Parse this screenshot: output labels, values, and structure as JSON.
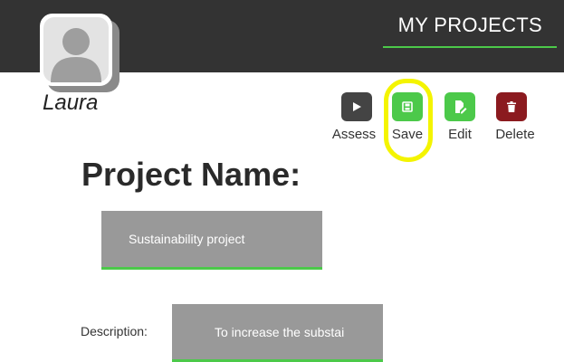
{
  "header": {
    "title": "MY PROJECTS"
  },
  "user": {
    "name": "Laura"
  },
  "actions": [
    {
      "label": "Assess",
      "icon": "play-icon"
    },
    {
      "label": "Save",
      "icon": "save-icon"
    },
    {
      "label": "Edit",
      "icon": "edit-icon"
    },
    {
      "label": "Delete",
      "icon": "trash-icon"
    }
  ],
  "form": {
    "heading": "Project Name:",
    "project_name_value": "Sustainability project",
    "description_label": "Description:",
    "description_value": "To increase the substai"
  },
  "colors": {
    "topbar": "#333333",
    "accent_green": "#4cc94a",
    "delete_red": "#8b1a1f",
    "field_gray": "#999999",
    "highlight_yellow": "#f4f400"
  }
}
